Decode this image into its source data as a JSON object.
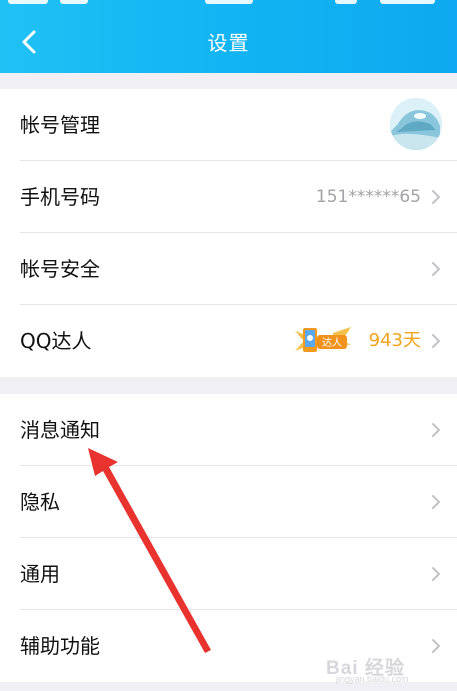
{
  "header": {
    "title": "设置",
    "back_icon": "chevron-left-icon",
    "background_color": "#12b4f3"
  },
  "group1": {
    "items": [
      {
        "label": "帐号管理",
        "value": "",
        "trailing": "avatar"
      },
      {
        "label": "手机号码",
        "value": "151******65",
        "trailing": "chevron-right-icon"
      },
      {
        "label": "帐号安全",
        "value": "",
        "trailing": "chevron-right-icon"
      },
      {
        "label": "QQ达人",
        "value": "943天",
        "badge_text": "达人",
        "trailing": "chevron-right-icon"
      }
    ]
  },
  "group2": {
    "items": [
      {
        "label": "消息通知",
        "trailing": "chevron-right-icon"
      },
      {
        "label": "隐私",
        "trailing": "chevron-right-icon"
      },
      {
        "label": "通用",
        "trailing": "chevron-right-icon"
      },
      {
        "label": "辅助功能",
        "trailing": "chevron-right-icon"
      }
    ]
  },
  "annotation": {
    "icon": "red-arrow-icon",
    "color": "#e8332f",
    "points_to": "消息通知"
  },
  "watermark": {
    "text": "Bai 经验",
    "sub": "jingyan.baidu.com"
  },
  "colors": {
    "accent": "#12b4f3",
    "badge_orange": "#f2a51b",
    "secondary_text": "#a3a3a8"
  }
}
